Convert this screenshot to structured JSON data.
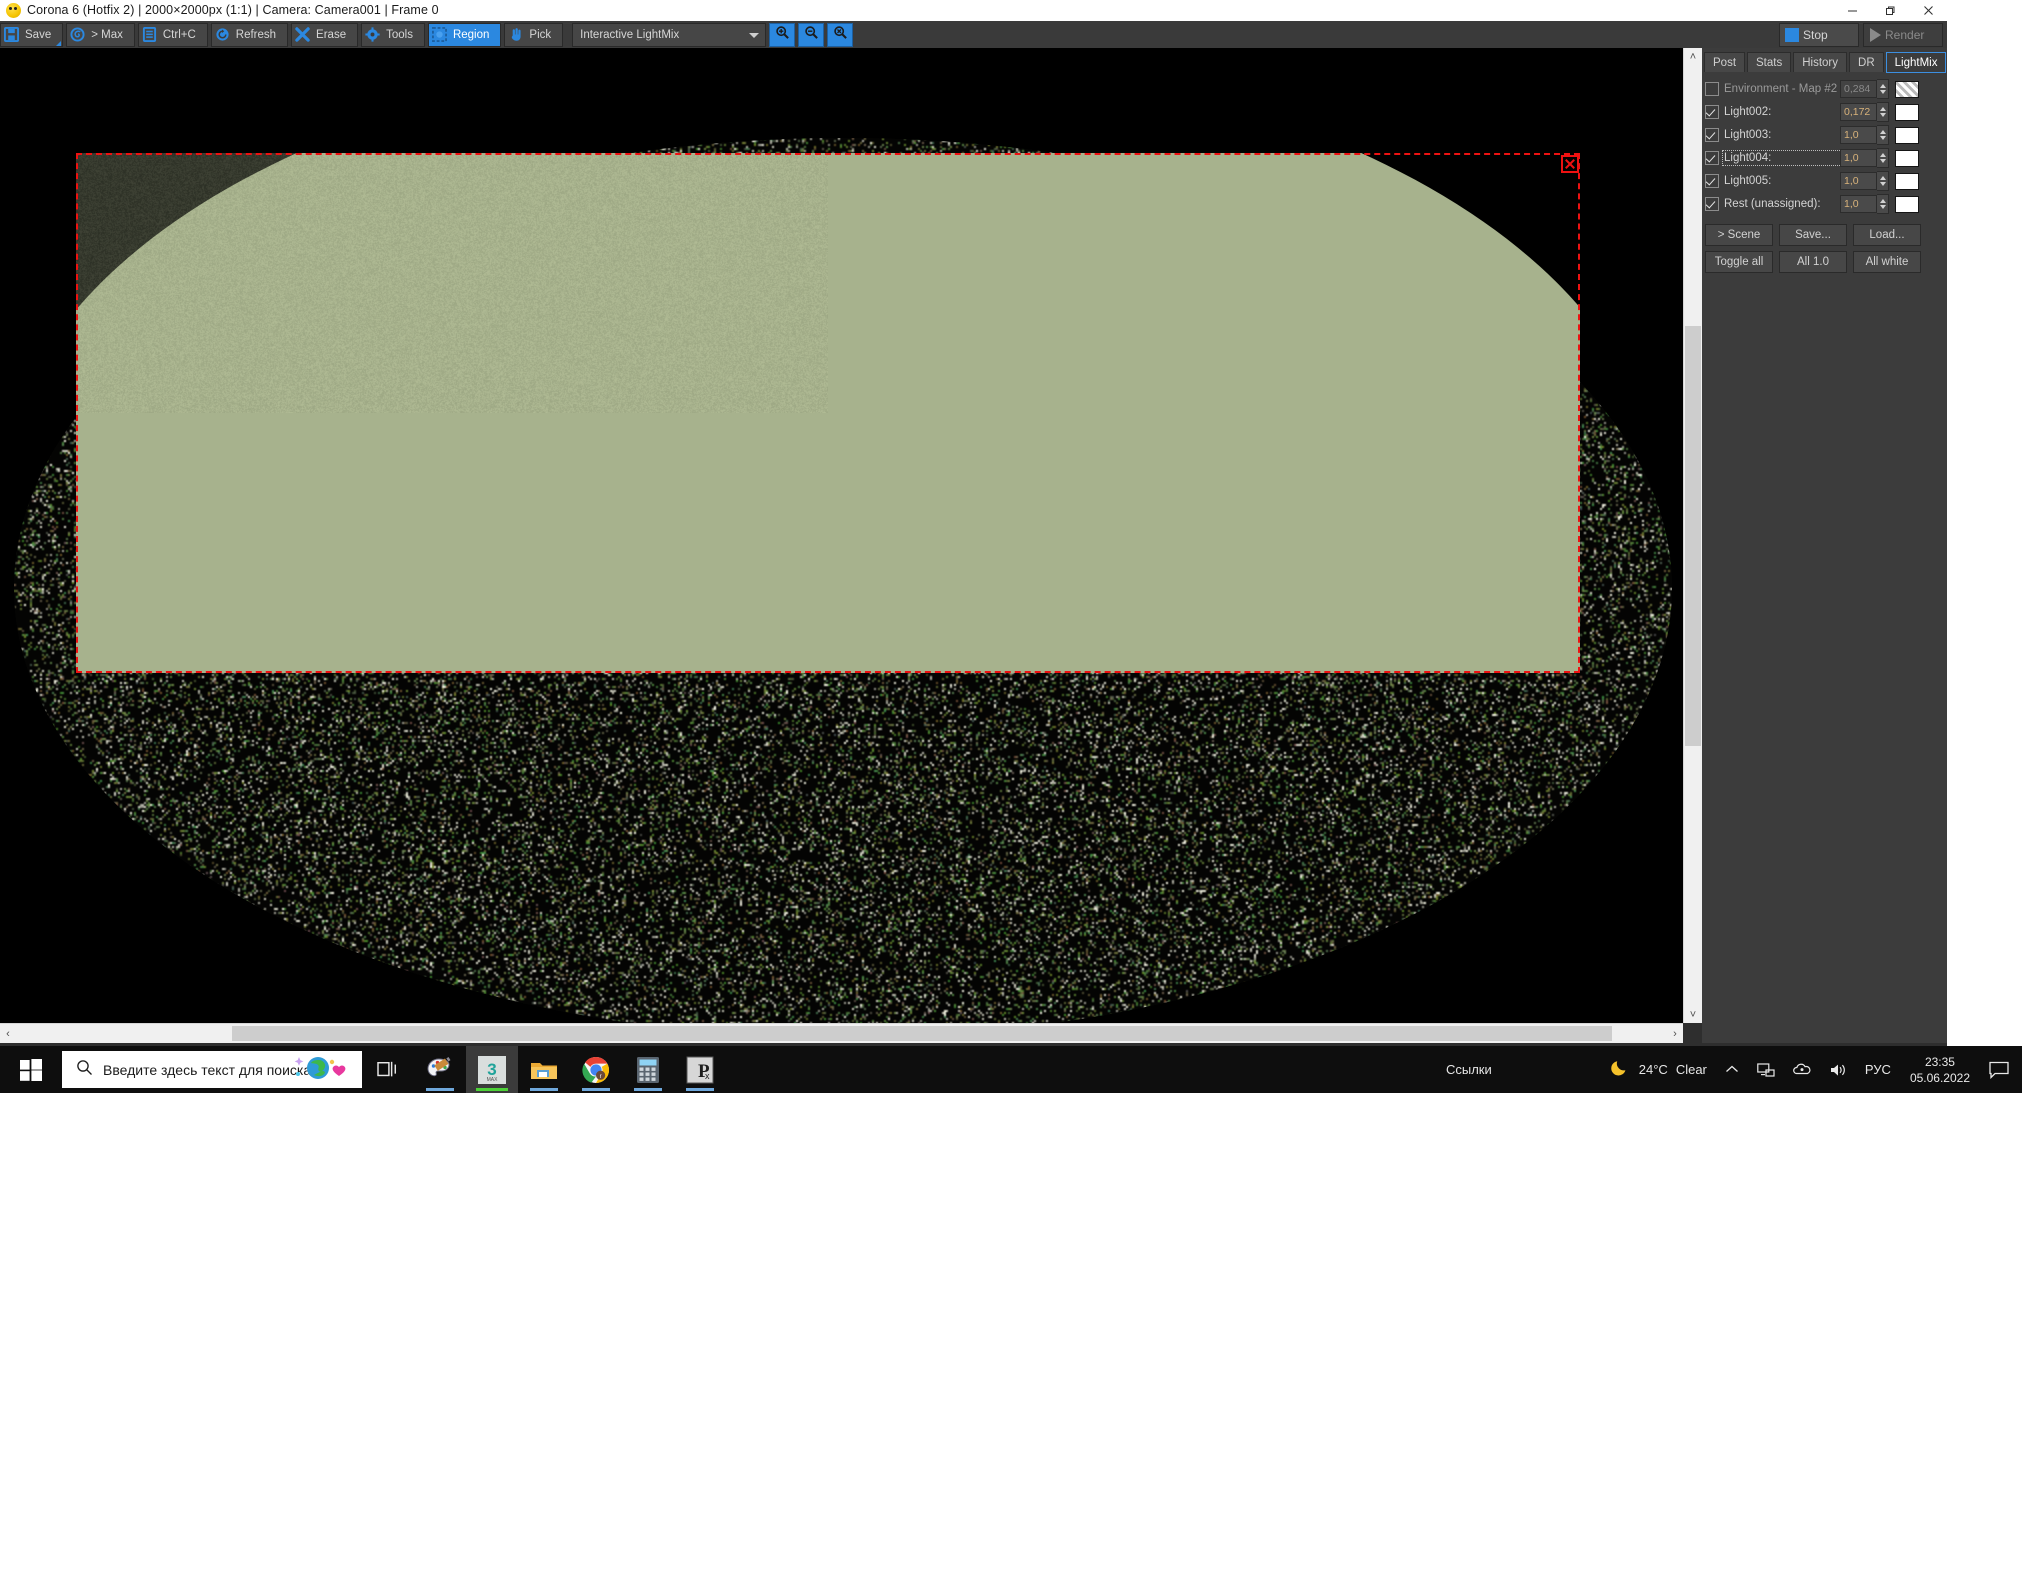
{
  "window": {
    "title": "Corona 6 (Hotfix 2) | 2000×2000px (1:1) | Camera: Camera001 | Frame 0",
    "app_icon": "corona-smiley-icon",
    "minimize": "minimize-icon",
    "maximize": "maximize-icon",
    "close": "close-icon"
  },
  "toolbar": {
    "buttons": [
      {
        "label": "Save",
        "icon": "save-disk-icon",
        "active": false,
        "dropdown": true
      },
      {
        "label": "> Max",
        "icon": "corona-swirl-icon",
        "active": false,
        "dropdown": false
      },
      {
        "label": "Ctrl+C",
        "icon": "copy-document-icon",
        "active": false,
        "dropdown": false
      },
      {
        "label": "Refresh",
        "icon": "refresh-circle-icon",
        "active": false,
        "dropdown": false
      },
      {
        "label": "Erase",
        "icon": "erase-x-icon",
        "active": false,
        "dropdown": false
      },
      {
        "label": "Tools",
        "icon": "gear-icon",
        "active": false,
        "dropdown": false
      },
      {
        "label": "Region",
        "icon": "region-marquee-icon",
        "active": true,
        "dropdown": true
      },
      {
        "label": "Pick",
        "icon": "hand-pointer-icon",
        "active": false,
        "dropdown": false
      }
    ],
    "mode_combo": {
      "value": "Interactive LightMix"
    },
    "zoom_buttons": [
      {
        "icon": "zoom-in-icon"
      },
      {
        "icon": "zoom-out-icon"
      },
      {
        "icon": "zoom-reset-icon"
      }
    ],
    "stop_button": {
      "label": "Stop",
      "enabled": true,
      "icon": "stop-square-icon"
    },
    "render_button": {
      "label": "Render",
      "enabled": false,
      "icon": "play-triangle-icon"
    }
  },
  "render_view": {
    "region_marker": "render-region-rectangle",
    "region_close": "region-remove-x-icon",
    "scroll_left": "‹",
    "scroll_right": "›",
    "scroll_up": "˄",
    "scroll_down": "˅"
  },
  "panel": {
    "tabs": [
      {
        "label": "Post",
        "selected": false
      },
      {
        "label": "Stats",
        "selected": false
      },
      {
        "label": "History",
        "selected": false
      },
      {
        "label": "DR",
        "selected": false
      },
      {
        "label": "LightMix",
        "selected": true
      }
    ],
    "lights": [
      {
        "name": "Environment - Map #2",
        "checked": false,
        "value": "0,284",
        "enabled": false,
        "swatch": "hatch",
        "focused": false
      },
      {
        "name": "Light002:",
        "checked": true,
        "value": "0,172",
        "enabled": true,
        "swatch": "#ffffff",
        "focused": false
      },
      {
        "name": "Light003:",
        "checked": true,
        "value": "1,0",
        "enabled": true,
        "swatch": "#ffffff",
        "focused": false
      },
      {
        "name": "Light004:",
        "checked": true,
        "value": "1,0",
        "enabled": true,
        "swatch": "#ffffff",
        "focused": true
      },
      {
        "name": "Light005:",
        "checked": true,
        "value": "1,0",
        "enabled": true,
        "swatch": "#ffffff",
        "focused": false
      },
      {
        "name": "Rest (unassigned):",
        "checked": true,
        "value": "1,0",
        "enabled": true,
        "swatch": "#ffffff",
        "focused": false
      }
    ],
    "buttons_row1": [
      "> Scene",
      "Save...",
      "Load..."
    ],
    "buttons_row2": [
      "Toggle all",
      "All 1.0",
      "All white"
    ]
  },
  "taskbar": {
    "start": "windows-start-icon",
    "search": {
      "placeholder": "Введите здесь текст для поиска",
      "icon": "search-icon"
    },
    "task_view": "task-view-icon",
    "apps": [
      {
        "name": "paint-app-icon",
        "running": true,
        "active": false
      },
      {
        "name": "3ds-max-app-icon",
        "running": true,
        "active": true
      },
      {
        "name": "file-explorer-icon",
        "running": true,
        "active": false
      },
      {
        "name": "google-chrome-icon",
        "running": true,
        "active": false
      },
      {
        "name": "calculator-icon",
        "running": true,
        "active": false
      },
      {
        "name": "pixplant-icon",
        "running": true,
        "active": false
      }
    ],
    "links_label": "Ссылки",
    "weather": {
      "icon": "moon-icon",
      "temperature": "24°C",
      "condition": "Clear"
    },
    "tray": [
      {
        "name": "show-hidden-icons-chevron",
        "glyph": "^"
      },
      {
        "name": "network-icon"
      },
      {
        "name": "onedrive-icon"
      },
      {
        "name": "volume-icon"
      }
    ],
    "language": "РУС",
    "clock": {
      "time": "23:35",
      "date": "05.06.2022"
    },
    "notifications": "notification-center-icon"
  },
  "colors": {
    "accent_blue": "#2b88e0",
    "region_red": "#ee1111",
    "sphere_green": "#a7b28d",
    "panel_bg": "#3c3c3c"
  }
}
